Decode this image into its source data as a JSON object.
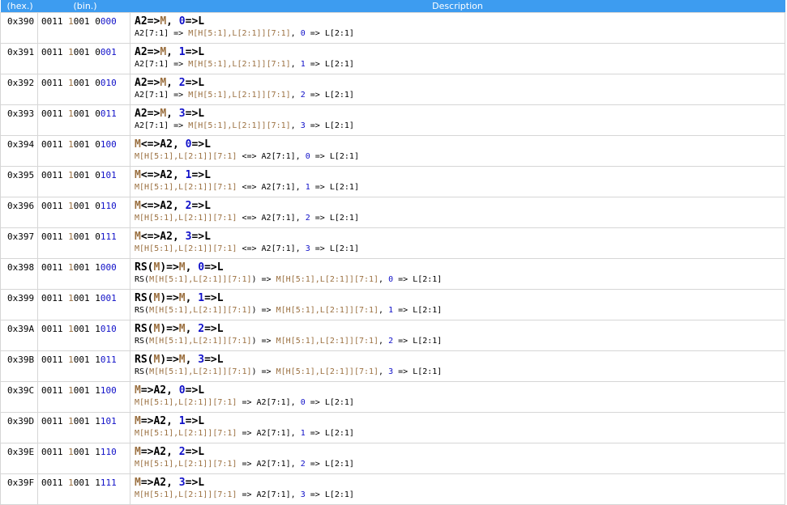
{
  "header": {
    "hex": "(hex.)",
    "bin": "(bin.)",
    "desc": "Description"
  },
  "colors": {
    "header_bg": "#3d9cf0",
    "memory": "#9b7040",
    "immediate": "#1010c8",
    "border": "#d6d6d6"
  },
  "rows": [
    {
      "hex": "0x390",
      "bin_a": "0011 ",
      "bin_b": "1",
      "bin_c": "0",
      "bin_d": "01 0",
      "bin_e": "000",
      "t": [
        [
          "k",
          "A2=>"
        ],
        [
          "m",
          "M"
        ],
        [
          "k",
          ", "
        ],
        [
          "b",
          "0"
        ],
        [
          "k",
          "=>L"
        ]
      ],
      "d": [
        [
          "k",
          "A2[7:1] => "
        ],
        [
          "m",
          "M[H[5:1],L[2:1]][7:1]"
        ],
        [
          "k",
          ", "
        ],
        [
          "b",
          "0"
        ],
        [
          "k",
          " => L[2:1]"
        ]
      ]
    },
    {
      "hex": "0x391",
      "bin_a": "0011 ",
      "bin_b": "1",
      "bin_c": "0",
      "bin_d": "01 0",
      "bin_e": "001",
      "t": [
        [
          "k",
          "A2=>"
        ],
        [
          "m",
          "M"
        ],
        [
          "k",
          ", "
        ],
        [
          "b",
          "1"
        ],
        [
          "k",
          "=>L"
        ]
      ],
      "d": [
        [
          "k",
          "A2[7:1] => "
        ],
        [
          "m",
          "M[H[5:1],L[2:1]][7:1]"
        ],
        [
          "k",
          ", "
        ],
        [
          "b",
          "1"
        ],
        [
          "k",
          " => L[2:1]"
        ]
      ]
    },
    {
      "hex": "0x392",
      "bin_a": "0011 ",
      "bin_b": "1",
      "bin_c": "0",
      "bin_d": "01 0",
      "bin_e": "010",
      "t": [
        [
          "k",
          "A2=>"
        ],
        [
          "m",
          "M"
        ],
        [
          "k",
          ", "
        ],
        [
          "b",
          "2"
        ],
        [
          "k",
          "=>L"
        ]
      ],
      "d": [
        [
          "k",
          "A2[7:1] => "
        ],
        [
          "m",
          "M[H[5:1],L[2:1]][7:1]"
        ],
        [
          "k",
          ", "
        ],
        [
          "b",
          "2"
        ],
        [
          "k",
          " => L[2:1]"
        ]
      ]
    },
    {
      "hex": "0x393",
      "bin_a": "0011 ",
      "bin_b": "1",
      "bin_c": "0",
      "bin_d": "01 0",
      "bin_e": "011",
      "t": [
        [
          "k",
          "A2=>"
        ],
        [
          "m",
          "M"
        ],
        [
          "k",
          ", "
        ],
        [
          "b",
          "3"
        ],
        [
          "k",
          "=>L"
        ]
      ],
      "d": [
        [
          "k",
          "A2[7:1] => "
        ],
        [
          "m",
          "M[H[5:1],L[2:1]][7:1]"
        ],
        [
          "k",
          ", "
        ],
        [
          "b",
          "3"
        ],
        [
          "k",
          " => L[2:1]"
        ]
      ]
    },
    {
      "hex": "0x394",
      "bin_a": "0011 ",
      "bin_b": "1",
      "bin_c": "0",
      "bin_d": "01 0",
      "bin_e": "100",
      "t": [
        [
          "m",
          "M"
        ],
        [
          "k",
          "<=>A2, "
        ],
        [
          "b",
          "0"
        ],
        [
          "k",
          "=>L"
        ]
      ],
      "d": [
        [
          "m",
          "M[H[5:1],L[2:1]][7:1]"
        ],
        [
          "k",
          " <=> A2[7:1], "
        ],
        [
          "b",
          "0"
        ],
        [
          "k",
          " => L[2:1]"
        ]
      ]
    },
    {
      "hex": "0x395",
      "bin_a": "0011 ",
      "bin_b": "1",
      "bin_c": "0",
      "bin_d": "01 0",
      "bin_e": "101",
      "t": [
        [
          "m",
          "M"
        ],
        [
          "k",
          "<=>A2, "
        ],
        [
          "b",
          "1"
        ],
        [
          "k",
          "=>L"
        ]
      ],
      "d": [
        [
          "m",
          "M[H[5:1],L[2:1]][7:1]"
        ],
        [
          "k",
          " <=> A2[7:1], "
        ],
        [
          "b",
          "1"
        ],
        [
          "k",
          " => L[2:1]"
        ]
      ]
    },
    {
      "hex": "0x396",
      "bin_a": "0011 ",
      "bin_b": "1",
      "bin_c": "0",
      "bin_d": "01 0",
      "bin_e": "110",
      "t": [
        [
          "m",
          "M"
        ],
        [
          "k",
          "<=>A2, "
        ],
        [
          "b",
          "2"
        ],
        [
          "k",
          "=>L"
        ]
      ],
      "d": [
        [
          "m",
          "M[H[5:1],L[2:1]][7:1]"
        ],
        [
          "k",
          " <=> A2[7:1], "
        ],
        [
          "b",
          "2"
        ],
        [
          "k",
          " => L[2:1]"
        ]
      ]
    },
    {
      "hex": "0x397",
      "bin_a": "0011 ",
      "bin_b": "1",
      "bin_c": "0",
      "bin_d": "01 0",
      "bin_e": "111",
      "t": [
        [
          "m",
          "M"
        ],
        [
          "k",
          "<=>A2, "
        ],
        [
          "b",
          "3"
        ],
        [
          "k",
          "=>L"
        ]
      ],
      "d": [
        [
          "m",
          "M[H[5:1],L[2:1]][7:1]"
        ],
        [
          "k",
          " <=> A2[7:1], "
        ],
        [
          "b",
          "3"
        ],
        [
          "k",
          " => L[2:1]"
        ]
      ]
    },
    {
      "hex": "0x398",
      "bin_a": "0011 ",
      "bin_b": "1",
      "bin_c": "0",
      "bin_d": "01 1",
      "bin_e": "000",
      "t": [
        [
          "k",
          "RS("
        ],
        [
          "m",
          "M"
        ],
        [
          "k",
          ")=>"
        ],
        [
          "m",
          "M"
        ],
        [
          "k",
          ", "
        ],
        [
          "b",
          "0"
        ],
        [
          "k",
          "=>L"
        ]
      ],
      "d": [
        [
          "k",
          "RS("
        ],
        [
          "m",
          "M[H[5:1],L[2:1]][7:1]"
        ],
        [
          "k",
          ") => "
        ],
        [
          "m",
          "M[H[5:1],L[2:1]][7:1]"
        ],
        [
          "k",
          ", "
        ],
        [
          "b",
          "0"
        ],
        [
          "k",
          " => L[2:1]"
        ]
      ]
    },
    {
      "hex": "0x399",
      "bin_a": "0011 ",
      "bin_b": "1",
      "bin_c": "0",
      "bin_d": "01 1",
      "bin_e": "001",
      "t": [
        [
          "k",
          "RS("
        ],
        [
          "m",
          "M"
        ],
        [
          "k",
          ")=>"
        ],
        [
          "m",
          "M"
        ],
        [
          "k",
          ", "
        ],
        [
          "b",
          "1"
        ],
        [
          "k",
          "=>L"
        ]
      ],
      "d": [
        [
          "k",
          "RS("
        ],
        [
          "m",
          "M[H[5:1],L[2:1]][7:1]"
        ],
        [
          "k",
          ") => "
        ],
        [
          "m",
          "M[H[5:1],L[2:1]][7:1]"
        ],
        [
          "k",
          ", "
        ],
        [
          "b",
          "1"
        ],
        [
          "k",
          " => L[2:1]"
        ]
      ]
    },
    {
      "hex": "0x39A",
      "bin_a": "0011 ",
      "bin_b": "1",
      "bin_c": "0",
      "bin_d": "01 1",
      "bin_e": "010",
      "t": [
        [
          "k",
          "RS("
        ],
        [
          "m",
          "M"
        ],
        [
          "k",
          ")=>"
        ],
        [
          "m",
          "M"
        ],
        [
          "k",
          ", "
        ],
        [
          "b",
          "2"
        ],
        [
          "k",
          "=>L"
        ]
      ],
      "d": [
        [
          "k",
          "RS("
        ],
        [
          "m",
          "M[H[5:1],L[2:1]][7:1]"
        ],
        [
          "k",
          ") => "
        ],
        [
          "m",
          "M[H[5:1],L[2:1]][7:1]"
        ],
        [
          "k",
          ", "
        ],
        [
          "b",
          "2"
        ],
        [
          "k",
          " => L[2:1]"
        ]
      ]
    },
    {
      "hex": "0x39B",
      "bin_a": "0011 ",
      "bin_b": "1",
      "bin_c": "0",
      "bin_d": "01 1",
      "bin_e": "011",
      "t": [
        [
          "k",
          "RS("
        ],
        [
          "m",
          "M"
        ],
        [
          "k",
          ")=>"
        ],
        [
          "m",
          "M"
        ],
        [
          "k",
          ", "
        ],
        [
          "b",
          "3"
        ],
        [
          "k",
          "=>L"
        ]
      ],
      "d": [
        [
          "k",
          "RS("
        ],
        [
          "m",
          "M[H[5:1],L[2:1]][7:1]"
        ],
        [
          "k",
          ") => "
        ],
        [
          "m",
          "M[H[5:1],L[2:1]][7:1]"
        ],
        [
          "k",
          ", "
        ],
        [
          "b",
          "3"
        ],
        [
          "k",
          " => L[2:1]"
        ]
      ]
    },
    {
      "hex": "0x39C",
      "bin_a": "0011 ",
      "bin_b": "1",
      "bin_c": "0",
      "bin_d": "01 1",
      "bin_e": "100",
      "t": [
        [
          "m",
          "M"
        ],
        [
          "k",
          "=>A2, "
        ],
        [
          "b",
          "0"
        ],
        [
          "k",
          "=>L"
        ]
      ],
      "d": [
        [
          "m",
          "M[H[5:1],L[2:1]][7:1]"
        ],
        [
          "k",
          " => A2[7:1], "
        ],
        [
          "b",
          "0"
        ],
        [
          "k",
          " => L[2:1]"
        ]
      ]
    },
    {
      "hex": "0x39D",
      "bin_a": "0011 ",
      "bin_b": "1",
      "bin_c": "0",
      "bin_d": "01 1",
      "bin_e": "101",
      "t": [
        [
          "m",
          "M"
        ],
        [
          "k",
          "=>A2, "
        ],
        [
          "b",
          "1"
        ],
        [
          "k",
          "=>L"
        ]
      ],
      "d": [
        [
          "m",
          "M[H[5:1],L[2:1]][7:1]"
        ],
        [
          "k",
          " => A2[7:1], "
        ],
        [
          "b",
          "1"
        ],
        [
          "k",
          " => L[2:1]"
        ]
      ]
    },
    {
      "hex": "0x39E",
      "bin_a": "0011 ",
      "bin_b": "1",
      "bin_c": "0",
      "bin_d": "01 1",
      "bin_e": "110",
      "t": [
        [
          "m",
          "M"
        ],
        [
          "k",
          "=>A2, "
        ],
        [
          "b",
          "2"
        ],
        [
          "k",
          "=>L"
        ]
      ],
      "d": [
        [
          "m",
          "M[H[5:1],L[2:1]][7:1]"
        ],
        [
          "k",
          " => A2[7:1], "
        ],
        [
          "b",
          "2"
        ],
        [
          "k",
          " => L[2:1]"
        ]
      ]
    },
    {
      "hex": "0x39F",
      "bin_a": "0011 ",
      "bin_b": "1",
      "bin_c": "0",
      "bin_d": "01 1",
      "bin_e": "111",
      "t": [
        [
          "m",
          "M"
        ],
        [
          "k",
          "=>A2, "
        ],
        [
          "b",
          "3"
        ],
        [
          "k",
          "=>L"
        ]
      ],
      "d": [
        [
          "m",
          "M[H[5:1],L[2:1]][7:1]"
        ],
        [
          "k",
          " => A2[7:1], "
        ],
        [
          "b",
          "3"
        ],
        [
          "k",
          " => L[2:1]"
        ]
      ]
    }
  ]
}
